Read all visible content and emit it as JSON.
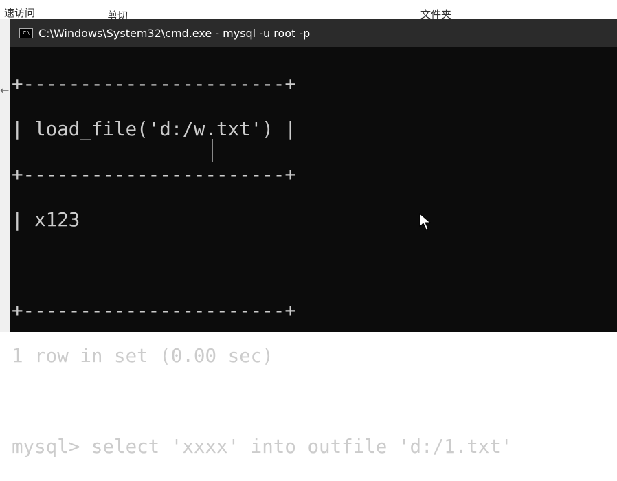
{
  "explorer_ribbon": {
    "items": [
      "速访问",
      "剪切",
      "文件夹"
    ]
  },
  "window": {
    "title": "C:\\Windows\\System32\\cmd.exe - mysql  -u root -p"
  },
  "terminal": {
    "lines": [
      "+-----------------------+",
      "| load_file('d:/w.txt') |",
      "+-----------------------+",
      "| x123",
      "",
      "+-----------------------+",
      "1 row in set (0.00 sec)",
      "",
      "mysql> select 'xxxx' into outfile 'd:/1.txt'"
    ]
  }
}
